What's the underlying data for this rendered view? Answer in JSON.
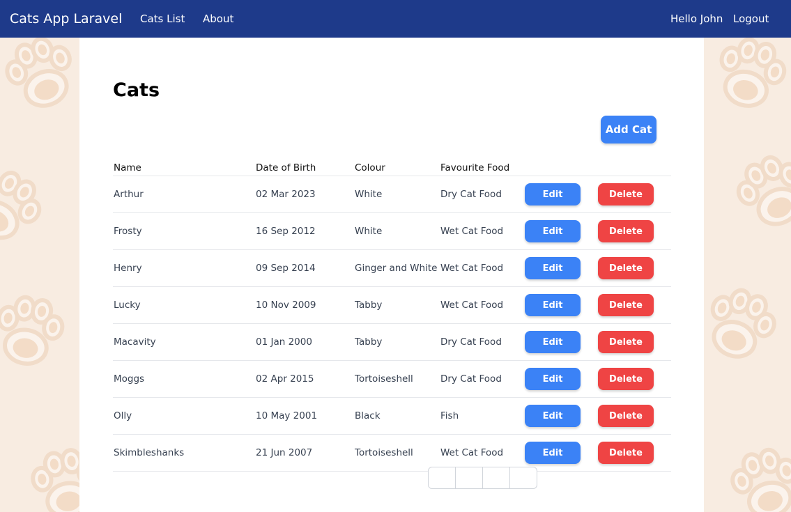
{
  "navbar": {
    "brand": "Cats App Laravel",
    "links": [
      {
        "label": "Cats List"
      },
      {
        "label": "About"
      }
    ],
    "greeting": "Hello John",
    "logout_label": "Logout",
    "background_color": "#1e3a8a"
  },
  "page": {
    "title": "Cats",
    "add_button_label": "Add Cat"
  },
  "table": {
    "headers": [
      "Name",
      "Date of Birth",
      "Colour",
      "Favourite Food"
    ],
    "edit_label": "Edit",
    "delete_label": "Delete",
    "rows": [
      {
        "name": "Arthur",
        "dob": "02 Mar 2023",
        "colour": "White",
        "food": "Dry Cat Food"
      },
      {
        "name": "Frosty",
        "dob": "16 Sep 2012",
        "colour": "White",
        "food": "Wet Cat Food"
      },
      {
        "name": "Henry",
        "dob": "09 Sep 2014",
        "colour": "Ginger and White",
        "food": "Wet Cat Food"
      },
      {
        "name": "Lucky",
        "dob": "10 Nov 2009",
        "colour": "Tabby",
        "food": "Wet Cat Food"
      },
      {
        "name": "Macavity",
        "dob": "01 Jan 2000",
        "colour": "Tabby",
        "food": "Dry Cat Food"
      },
      {
        "name": "Moggs",
        "dob": "02 Apr 2015",
        "colour": "Tortoiseshell",
        "food": "Dry Cat Food"
      },
      {
        "name": "Olly",
        "dob": "10 May 2001",
        "colour": "Black",
        "food": "Fish"
      },
      {
        "name": "Skimbleshanks",
        "dob": "21 Jun 2007",
        "colour": "Tortoiseshell",
        "food": "Wet Cat Food"
      }
    ]
  },
  "pagination": {
    "items": [
      "",
      "",
      "",
      ""
    ]
  },
  "colors": {
    "primary_button": "#3b82f6",
    "danger_button": "#ef4444",
    "background": "#f8ece1"
  },
  "icons": {
    "background_pattern": "paw-print-icon"
  }
}
